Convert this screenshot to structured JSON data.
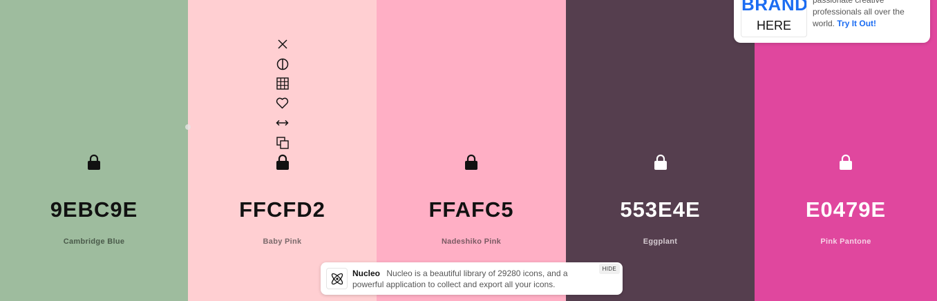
{
  "colors": [
    {
      "hex": "9EBC9E",
      "name": "Cambridge Blue",
      "background": "#9EBC9E",
      "text_color": "#111111",
      "name_color": "#4a5a4a"
    },
    {
      "hex": "FFCFD2",
      "name": "Baby Pink",
      "background": "#FFCFD2",
      "text_color": "#111111",
      "name_color": "#7a6a6b"
    },
    {
      "hex": "FFAFC5",
      "name": "Nadeshiko Pink",
      "background": "#FFAFC5",
      "text_color": "#111111",
      "name_color": "#7a5a63"
    },
    {
      "hex": "553E4E",
      "name": "Eggplant",
      "background": "#553E4E",
      "text_color": "#ffffff",
      "name_color": "#d5cbd1"
    },
    {
      "hex": "E0479E",
      "name": "Pink Pantone",
      "background": "#E0479E",
      "text_color": "#ffffff",
      "name_color": "#f6d2e6"
    }
  ],
  "column_tools": [
    "close-icon",
    "contrast-icon",
    "shades-grid-icon",
    "heart-icon",
    "drag-arrows-icon",
    "copy-icon"
  ],
  "ad": {
    "logo_big": "BRAND",
    "logo_small": "HERE",
    "text": "passionate creative professionals all over the world.",
    "cta": "Try It Out!"
  },
  "banner": {
    "title": "Nucleo",
    "text": "Nucleo is a beautiful library of 29280 icons, and a powerful application to collect and export all your icons.",
    "hide_label": "HIDE"
  }
}
